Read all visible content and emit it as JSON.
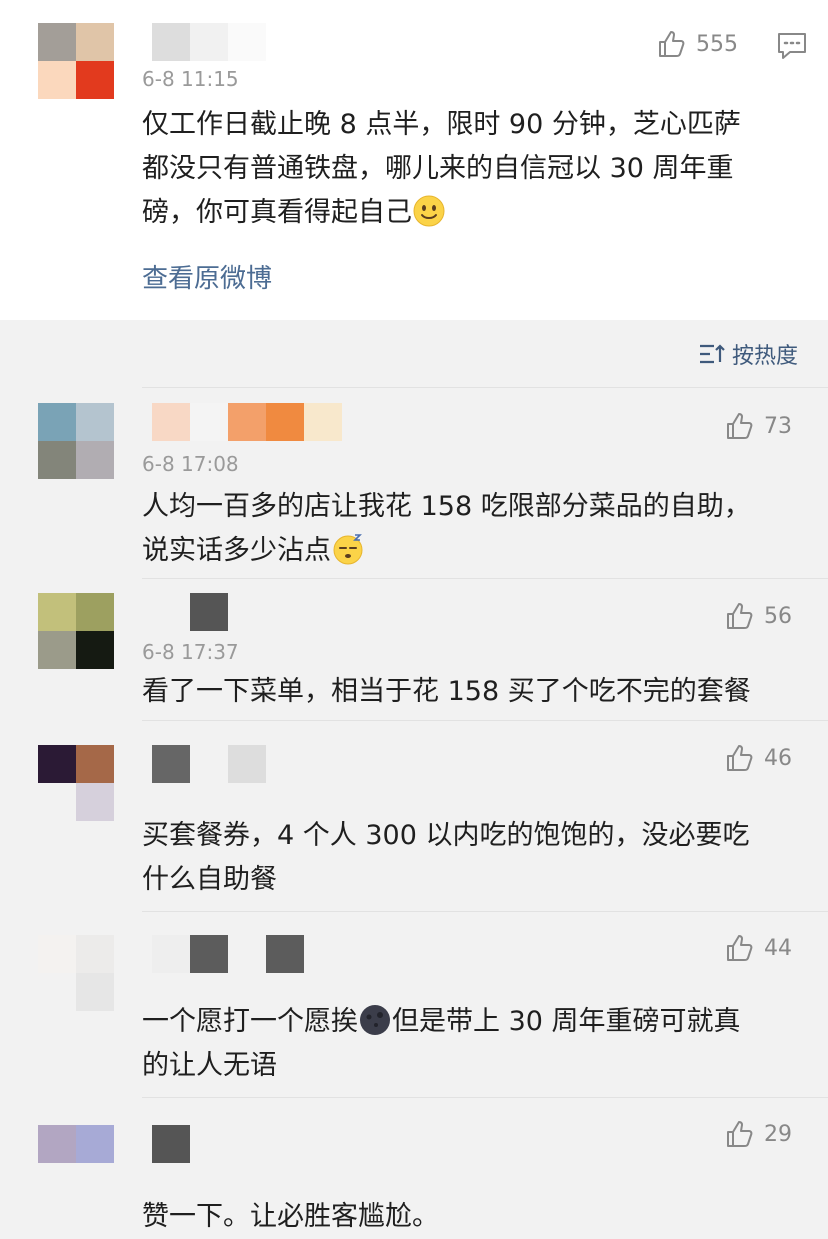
{
  "top_comment": {
    "time": "6-8 11:15",
    "likes": "555",
    "text_line1": "仅工作日截止晚 8 点半，限时 90 分钟，芝心匹萨",
    "text_line2": "都没只有普通铁盘，哪儿来的自信冠以 30 周年重",
    "text_line3": "磅，你可真看得起自己",
    "view_original": "查看原微博",
    "avatar_colors": [
      "#a39e98",
      "#e0c5a8",
      "#fbd8bd",
      "#e23a1e"
    ],
    "name_colors": [
      "#dddddd",
      "#f1f1f1",
      "#fafafa"
    ]
  },
  "sort": {
    "label": "按热度"
  },
  "comments": [
    {
      "time": "6-8 17:08",
      "likes": "73",
      "line1": "人均一百多的店让我花 158 吃限部分菜品的自助，",
      "line2": "说实话多少沾点",
      "avatar_colors": [
        "#7aa3b6",
        "#b4c4cf",
        "#83857a",
        "#b1adb2"
      ],
      "name_colors": [
        "#f8d8c5",
        "#f4f4f4",
        "#f3a06a",
        "#f08a40",
        "#f8e8cc"
      ]
    },
    {
      "time": "6-8 17:37",
      "likes": "56",
      "line1": "看了一下菜单，相当于花 158 买了个吃不完的套餐",
      "line2": "",
      "avatar_colors": [
        "#c2c07b",
        "#9da060",
        "#9b9b8a",
        "#151a12"
      ],
      "name_colors": [
        "#f2f2f2",
        "#555555"
      ]
    },
    {
      "time": "",
      "likes": "46",
      "line1": "买套餐券，4 个人 300 以内吃的饱饱的，没必要吃",
      "line2": "什么自助餐",
      "avatar_colors": [
        "#2b1a35",
        "#a56848",
        "#f2f2f2",
        "#d6d0dc"
      ],
      "name_colors": [
        "#666666",
        "#f2f2f2",
        "#dddddd"
      ]
    },
    {
      "time": "",
      "likes": "44",
      "line1": "一个愿打一个愿挨",
      "line1b": "但是带上 30 周年重磅可就真",
      "line2": "的让人无语",
      "avatar_colors": [
        "#f4f2f0",
        "#ecebea",
        "#f2f2f2",
        "#e6e6e6"
      ],
      "name_colors": [
        "#eeeeee",
        "#5c5c5c",
        "#f2f2f2",
        "#5c5c5c"
      ]
    },
    {
      "time": "",
      "likes": "29",
      "line1": "赞一下。让必胜客尴尬。",
      "line2": "",
      "avatar_colors": [
        "#b2a6c2",
        "#a7aad6",
        "#f2f2f2",
        "#f2f2f2"
      ],
      "name_colors": [
        "#555555"
      ]
    }
  ]
}
